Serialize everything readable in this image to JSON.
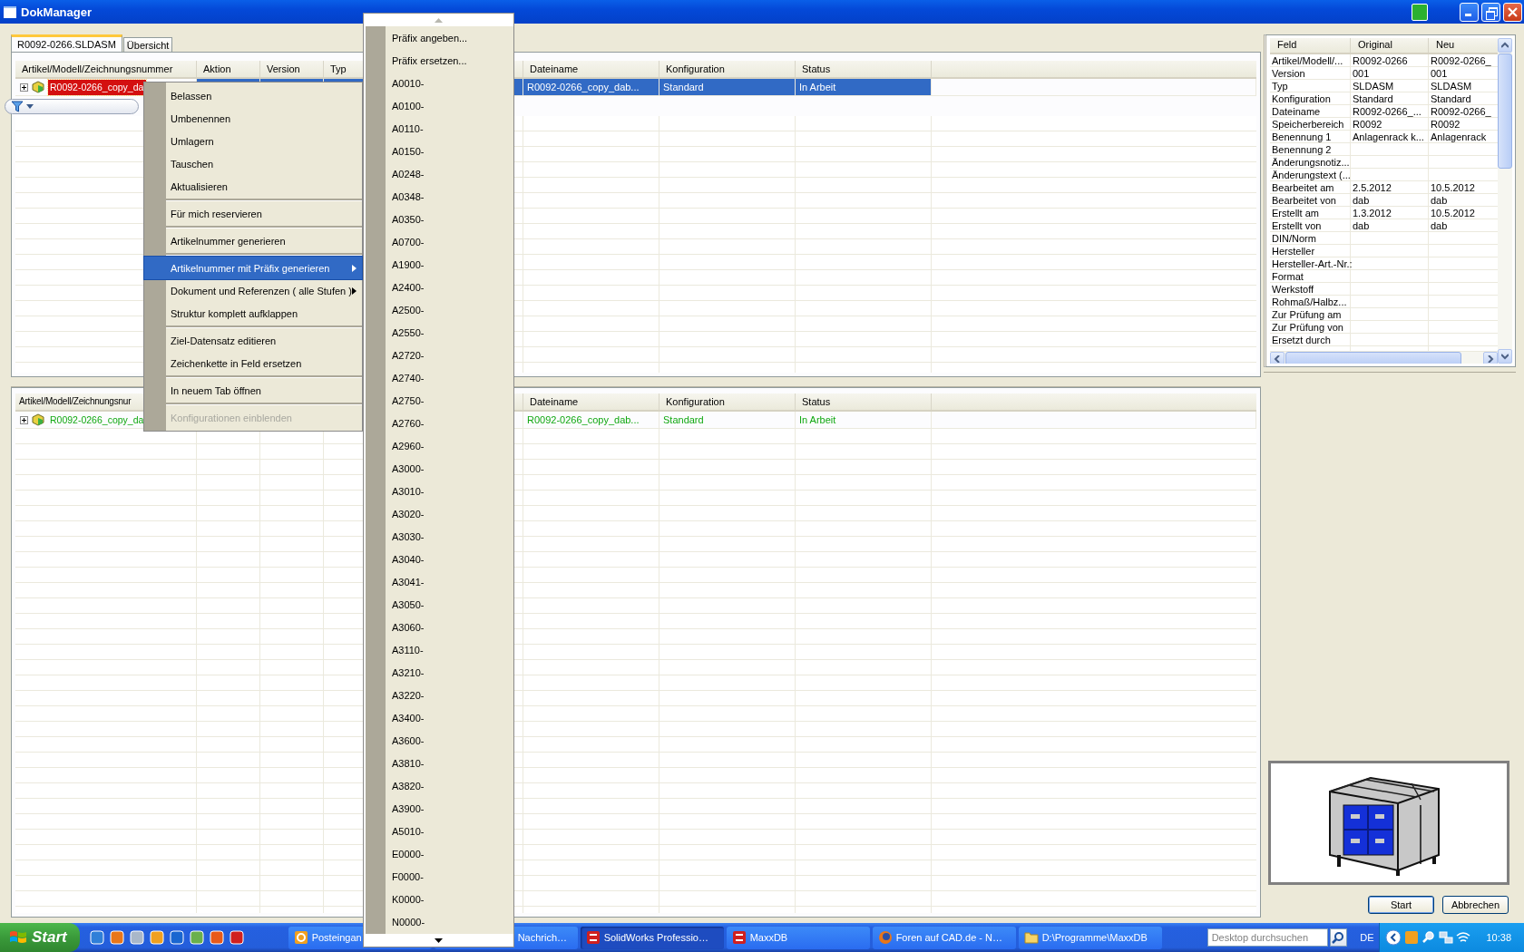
{
  "window": {
    "title": "DokManager"
  },
  "tabs": [
    {
      "label": "R0092-0266.SLDASM",
      "selected": true
    },
    {
      "label": "Übersicht",
      "selected": false
    }
  ],
  "upper_table": {
    "columns": [
      "Artikel/Modell/Zeichnungsnummer",
      "Aktion",
      "Version",
      "Typ",
      "Dateiname",
      "Konfiguration",
      "Status"
    ],
    "rows": [
      {
        "expanded": false,
        "selected": true,
        "flagged": true,
        "name": "R0092-0266_copy_da",
        "dateiname": "R0092-0266_copy_dab...",
        "konfiguration": "Standard",
        "status": "In Arbeit"
      }
    ]
  },
  "lower_table": {
    "columns": [
      "Artikel/Modell/Zeichnungsnur",
      "Dateiname",
      "Konfiguration",
      "Status"
    ],
    "rows": [
      {
        "expanded": false,
        "selected": false,
        "flagged": false,
        "color": "#11a811",
        "name": "R0092-0266_copy_da",
        "dateiname": "R0092-0266_copy_dab...",
        "konfiguration": "Standard",
        "status": "In Arbeit"
      }
    ]
  },
  "properties": {
    "columns": [
      "Feld",
      "Original",
      "Neu"
    ],
    "rows": [
      {
        "field": "Artikel/Modell/...",
        "original": "R0092-0266",
        "neu": "R0092-0266_"
      },
      {
        "field": "Version",
        "original": "001",
        "neu": "001"
      },
      {
        "field": "Typ",
        "original": "SLDASM",
        "neu": "SLDASM"
      },
      {
        "field": "Konfiguration",
        "original": "Standard",
        "neu": "Standard"
      },
      {
        "field": "Dateiname",
        "original": "R0092-0266_...",
        "neu": "R0092-0266_"
      },
      {
        "field": "Speicherbereich",
        "original": "R0092",
        "neu": "R0092"
      },
      {
        "field": "Benennung 1",
        "original": "Anlagenrack k...",
        "neu": "Anlagenrack"
      },
      {
        "field": "Benennung 2"
      },
      {
        "field": "Änderungsnotiz..."
      },
      {
        "field": "Änderungstext (..."
      },
      {
        "field": "Bearbeitet am",
        "original": "2.5.2012",
        "neu": "10.5.2012"
      },
      {
        "field": "Bearbeitet von",
        "original": "dab",
        "neu": "dab"
      },
      {
        "field": "Erstellt am",
        "original": "1.3.2012",
        "neu": "10.5.2012"
      },
      {
        "field": "Erstellt von",
        "original": "dab",
        "neu": "dab"
      },
      {
        "field": "DIN/Norm"
      },
      {
        "field": "Hersteller"
      },
      {
        "field": "Hersteller-Art.-Nr.:"
      },
      {
        "field": "Format"
      },
      {
        "field": "Werkstoff"
      },
      {
        "field": "Rohmaß/Halbz..."
      },
      {
        "field": "Zur Prüfung am"
      },
      {
        "field": "Zur Prüfung von"
      },
      {
        "field": "Ersetzt durch"
      }
    ]
  },
  "buttons": [
    "Start",
    "Abbrechen"
  ],
  "context_menu": {
    "items": [
      {
        "kind": "item",
        "label": "Belassen",
        "selected": false,
        "disabled": false,
        "submenu": false
      },
      {
        "kind": "item",
        "label": "Umbenennen",
        "selected": false,
        "disabled": false,
        "submenu": false
      },
      {
        "kind": "item",
        "label": "Umlagern",
        "selected": false,
        "disabled": false,
        "submenu": false
      },
      {
        "kind": "item",
        "label": "Tauschen",
        "selected": false,
        "disabled": false,
        "submenu": false
      },
      {
        "kind": "item",
        "label": "Aktualisieren",
        "selected": false,
        "disabled": false,
        "submenu": false
      },
      {
        "kind": "separator"
      },
      {
        "kind": "item",
        "label": "Für mich reservieren",
        "selected": false,
        "disabled": false,
        "submenu": false
      },
      {
        "kind": "separator"
      },
      {
        "kind": "item",
        "label": "Artikelnummer generieren",
        "selected": false,
        "disabled": false,
        "submenu": false
      },
      {
        "kind": "separator"
      },
      {
        "kind": "item",
        "label": "Artikelnummer mit Präfix generieren",
        "selected": true,
        "disabled": false,
        "submenu": true
      },
      {
        "kind": "item",
        "label": "Dokument und Referenzen ( alle Stufen )",
        "selected": false,
        "disabled": false,
        "submenu": true
      },
      {
        "kind": "item",
        "label": "Struktur komplett aufklappen",
        "selected": false,
        "disabled": false,
        "submenu": false
      },
      {
        "kind": "separator"
      },
      {
        "kind": "item",
        "label": "Ziel-Datensatz editieren",
        "selected": false,
        "disabled": false,
        "submenu": false
      },
      {
        "kind": "item",
        "label": "Zeichenkette in Feld ersetzen",
        "selected": false,
        "disabled": false,
        "submenu": false
      },
      {
        "kind": "separator"
      },
      {
        "kind": "item",
        "label": "In neuem Tab öffnen",
        "selected": false,
        "disabled": false,
        "submenu": false
      },
      {
        "kind": "separator"
      },
      {
        "kind": "item",
        "label": "Konfigurationen einblenden",
        "selected": false,
        "disabled": true,
        "submenu": false
      }
    ]
  },
  "submenu": {
    "items": [
      {
        "label": "Präfix angeben...",
        "selected": false
      },
      {
        "label": "Präfix ersetzen...",
        "selected": false
      },
      {
        "label": "A0010-",
        "selected": false
      },
      {
        "label": "A0100-",
        "selected": false
      },
      {
        "label": "A0110-",
        "selected": false
      },
      {
        "label": "A0150-",
        "selected": false
      },
      {
        "label": "A0248-",
        "selected": false
      },
      {
        "label": "A0348-",
        "selected": false
      },
      {
        "label": "A0350-",
        "selected": false
      },
      {
        "label": "A0700-",
        "selected": false
      },
      {
        "label": "A1900-",
        "selected": false
      },
      {
        "label": "A2400-",
        "selected": false
      },
      {
        "label": "A2500-",
        "selected": false
      },
      {
        "label": "A2550-",
        "selected": false
      },
      {
        "label": "A2720-",
        "selected": false
      },
      {
        "label": "A2740-",
        "selected": false
      },
      {
        "label": "A2750-",
        "selected": false
      },
      {
        "label": "A2760-",
        "selected": false
      },
      {
        "label": "A2960-",
        "selected": false
      },
      {
        "label": "A3000-",
        "selected": false
      },
      {
        "label": "A3010-",
        "selected": false
      },
      {
        "label": "A3020-",
        "selected": false
      },
      {
        "label": "A3030-",
        "selected": false
      },
      {
        "label": "A3040-",
        "selected": false
      },
      {
        "label": "A3041-",
        "selected": false
      },
      {
        "label": "A3050-",
        "selected": false
      },
      {
        "label": "A3060-",
        "selected": false
      },
      {
        "label": "A3110-",
        "selected": false
      },
      {
        "label": "A3210-",
        "selected": false
      },
      {
        "label": "A3220-",
        "selected": false
      },
      {
        "label": "A3400-",
        "selected": false
      },
      {
        "label": "A3600-",
        "selected": false
      },
      {
        "label": "A3810-",
        "selected": false
      },
      {
        "label": "A3820-",
        "selected": false
      },
      {
        "label": "A3900-",
        "selected": false
      },
      {
        "label": "A5010-",
        "selected": false
      },
      {
        "label": "E0000-",
        "selected": false
      },
      {
        "label": "F0000-",
        "selected": false
      },
      {
        "label": "K0000-",
        "selected": false
      },
      {
        "label": "N0000-",
        "selected": false
      }
    ]
  },
  "taskbar": {
    "start": "Start",
    "tasks": [
      {
        "label": "Posteingan",
        "active": false,
        "kind": "mail"
      },
      {
        "label": "Nachrich…",
        "active": false,
        "kind": "hidden"
      },
      {
        "label": "SolidWorks Professio…",
        "active": true,
        "kind": "cad"
      },
      {
        "label": "MaxxDB",
        "active": false,
        "kind": "cad"
      },
      {
        "label": "Foren auf CAD.de - N…",
        "active": false,
        "kind": "browser"
      },
      {
        "label": "D:\\Programme\\MaxxDB",
        "active": false,
        "kind": "folder"
      }
    ],
    "search": {
      "placeholder": "Desktop durchsuchen"
    },
    "language": "DE",
    "clock": "10:38"
  }
}
